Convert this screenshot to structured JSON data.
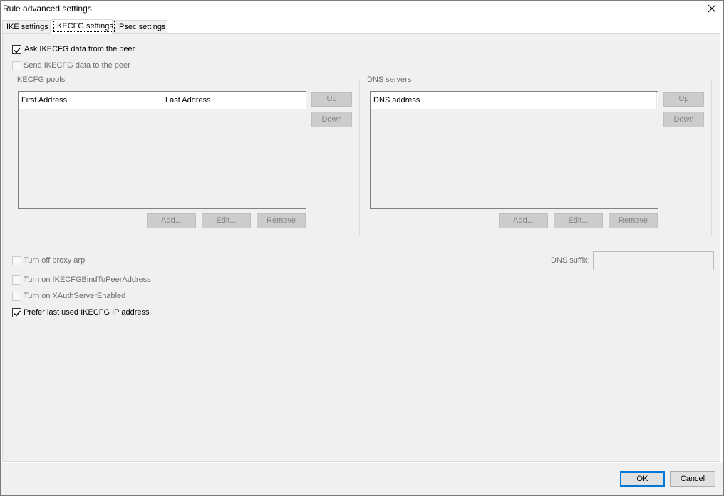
{
  "window": {
    "title": "Rule advanced settings"
  },
  "tabs": [
    {
      "label": "IKE settings"
    },
    {
      "label": "IKECFG settings"
    },
    {
      "label": "IPsec settings"
    }
  ],
  "options_top": {
    "ask_ikecfg": {
      "label": "Ask IKECFG data from the peer",
      "checked": true,
      "enabled": true
    },
    "send_ikecfg": {
      "label": "Send IKECFG data to the peer",
      "checked": false,
      "enabled": false
    }
  },
  "pools": {
    "legend": "IKECFG pools",
    "columns": [
      "First Address",
      "Last Address"
    ],
    "rows": [],
    "up_label": "Up",
    "down_label": "Down",
    "add_label": "Add...",
    "edit_label": "Edit...",
    "remove_label": "Remove"
  },
  "dns": {
    "legend": "DNS servers",
    "columns": [
      "DNS address"
    ],
    "rows": [],
    "up_label": "Up",
    "down_label": "Down",
    "add_label": "Add...",
    "edit_label": "Edit...",
    "remove_label": "Remove"
  },
  "options_bottom": {
    "proxy_arp": {
      "label": "Turn off proxy arp",
      "checked": false,
      "enabled": false
    },
    "bind_peer": {
      "label": "Turn on IKECFGBindToPeerAddress",
      "checked": false,
      "enabled": false
    },
    "xauth": {
      "label": "Turn on XAuthServerEnabled",
      "checked": false,
      "enabled": false
    },
    "prefer_last": {
      "label": "Prefer last used IKECFG IP address",
      "checked": true,
      "enabled": true
    }
  },
  "dns_suffix": {
    "label": "DNS suffix:",
    "value": ""
  },
  "footer": {
    "ok_label": "OK",
    "cancel_label": "Cancel"
  },
  "colors": {
    "accent": "#0078d7",
    "pane": "#f0f0f0",
    "disabled_text": "#6d6d6d"
  }
}
